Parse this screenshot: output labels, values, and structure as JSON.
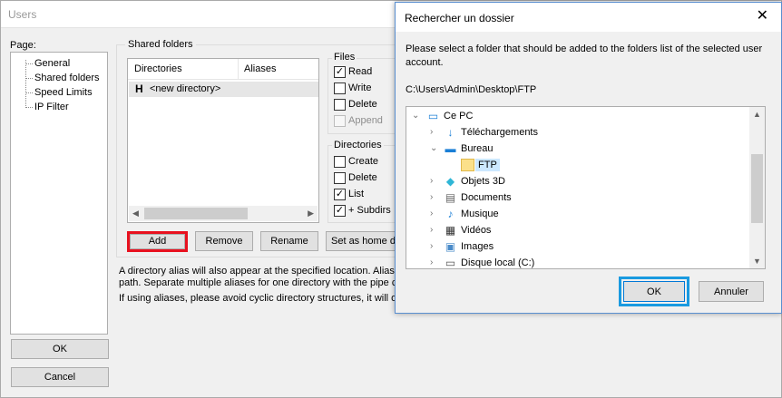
{
  "users_window": {
    "title": "Users",
    "page_label": "Page:",
    "pages": [
      "General",
      "Shared folders",
      "Speed Limits",
      "IP Filter"
    ],
    "ok_label": "OK",
    "cancel_label": "Cancel",
    "shared_folders": {
      "group_title": "Shared folders",
      "columns": [
        "Directories",
        "Aliases"
      ],
      "rows": [
        {
          "icon": "H",
          "directory": "<new directory>",
          "alias": ""
        }
      ],
      "files_group": "Files",
      "file_perms": [
        {
          "label": "Read",
          "checked": true,
          "enabled": true
        },
        {
          "label": "Write",
          "checked": false,
          "enabled": true
        },
        {
          "label": "Delete",
          "checked": false,
          "enabled": true
        },
        {
          "label": "Append",
          "checked": false,
          "enabled": false
        }
      ],
      "dirs_group": "Directories",
      "dir_perms": [
        {
          "label": "Create",
          "checked": false
        },
        {
          "label": "Delete",
          "checked": false
        },
        {
          "label": "List",
          "checked": true
        },
        {
          "label": "+ Subdirs",
          "checked": true
        }
      ],
      "buttons": {
        "add": "Add",
        "remove": "Remove",
        "rename": "Rename",
        "home": "Set as home dir"
      },
      "info_lines": [
        "A directory alias will also appear at the specified location. Aliases",
        "path. Separate multiple aliases for one directory with the pipe cha",
        "If using aliases, please avoid cyclic directory structures, it will only"
      ]
    }
  },
  "folder_dialog": {
    "title": "Rechercher un dossier",
    "close_glyph": "✕",
    "prompt": "Please select a folder that should be added to the folders list of the selected user account.",
    "path": "C:\\Users\\Admin\\Desktop\\FTP",
    "tree": [
      {
        "label": "Ce PC",
        "icon": "pc-icon",
        "level": 0,
        "expanded": true
      },
      {
        "label": "Téléchargements",
        "icon": "download-icon",
        "level": 1,
        "expanded": false
      },
      {
        "label": "Bureau",
        "icon": "desktop-icon",
        "level": 1,
        "expanded": true
      },
      {
        "label": "FTP",
        "icon": "folder-icon",
        "level": 2,
        "selected": true
      },
      {
        "label": "Objets 3D",
        "icon": "cube-icon",
        "level": 1,
        "expanded": false
      },
      {
        "label": "Documents",
        "icon": "document-icon",
        "level": 1,
        "expanded": false
      },
      {
        "label": "Musique",
        "icon": "music-icon",
        "level": 1,
        "expanded": false
      },
      {
        "label": "Vidéos",
        "icon": "video-icon",
        "level": 1,
        "expanded": false
      },
      {
        "label": "Images",
        "icon": "image-icon",
        "level": 1,
        "expanded": false
      },
      {
        "label": "Disque local (C:)",
        "icon": "drive-icon",
        "level": 1,
        "expanded": false
      }
    ],
    "ok_label": "OK",
    "cancel_label": "Annuler"
  },
  "colors": {
    "highlight_red": "#e8111f",
    "highlight_blue": "#1a9ae0",
    "selection": "#cce8ff"
  }
}
